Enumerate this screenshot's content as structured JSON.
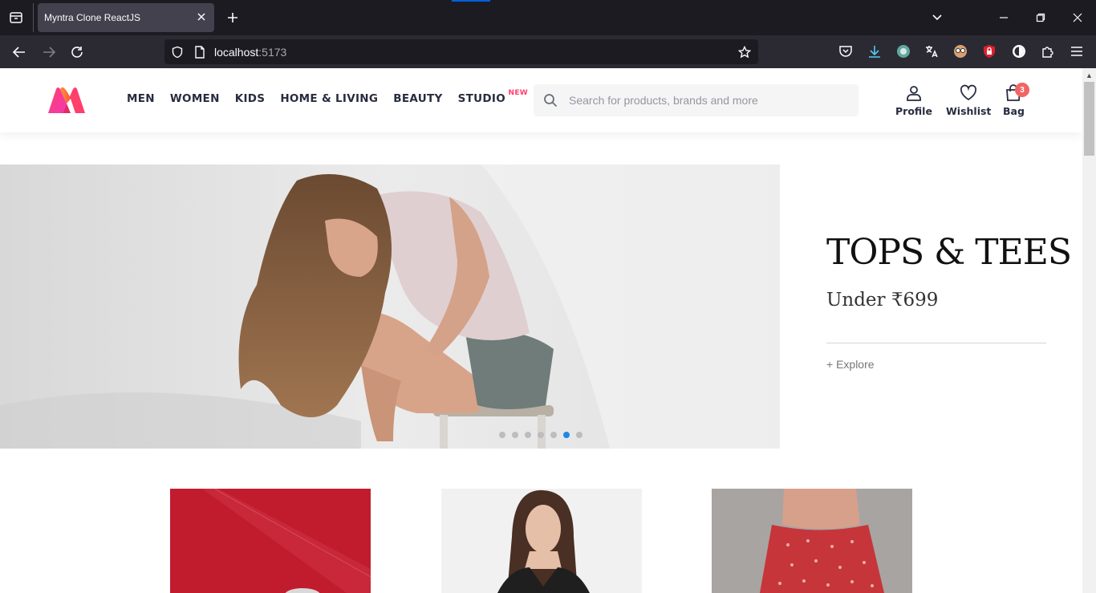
{
  "browser": {
    "tab_title": "Myntra Clone ReactJS",
    "url_host": "localhost",
    "url_port": ":5173"
  },
  "header": {
    "menu": [
      {
        "label": "MEN"
      },
      {
        "label": "WOMEN"
      },
      {
        "label": "KIDS"
      },
      {
        "label": "HOME & LIVING"
      },
      {
        "label": "BEAUTY"
      },
      {
        "label": "STUDIO",
        "badge": "NEW"
      }
    ],
    "search_placeholder": "Search for products, brands and more",
    "actions": {
      "profile": "Profile",
      "wishlist": "Wishlist",
      "bag": "Bag",
      "bag_count": "3"
    }
  },
  "banner": {
    "title": "TOPS & TEES",
    "subtitle": "Under ₹699",
    "cta": "+ Explore",
    "slide_count": 7,
    "active_slide": 6
  },
  "colors": {
    "brand_pink": "#ff3f6c",
    "text_dark": "#282c3f",
    "dot_active": "#1e88e5"
  }
}
